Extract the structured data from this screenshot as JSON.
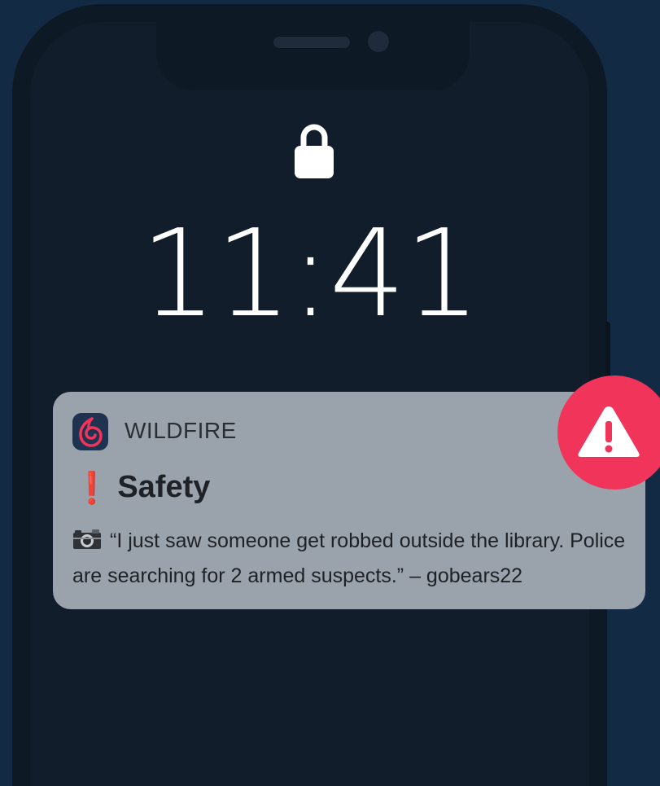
{
  "colors": {
    "background": "#132a45",
    "notification": "#9aa3ab",
    "alert": "#f0345a",
    "exclamation": "#e0141f"
  },
  "lockscreen": {
    "lock_icon": "lock-icon",
    "time": "11:41"
  },
  "notification": {
    "app_icon": "wildfire-flame-icon",
    "app_name": "WILDFIRE",
    "title_icon": "exclamation-icon",
    "title_prefix": "❗",
    "title": "Safety",
    "body_icon": "camera-icon",
    "body": "“I just saw someone get robbed outside the library. Police are searching for 2 armed suspects.” – gobears22"
  },
  "alert_badge": {
    "icon": "warning-triangle-icon"
  }
}
